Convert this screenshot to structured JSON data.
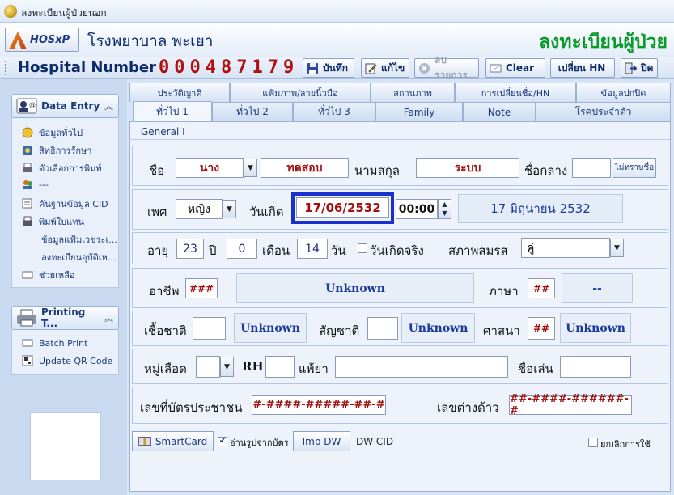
{
  "window": {
    "title": "ลงทะเบียนผู้ป่วยนอก"
  },
  "banner": {
    "logo_text": "HOSxP",
    "hospital_name": "โรงพยาบาล พะเยา",
    "page_title": "ลงทะเบียนผู้ป่วย"
  },
  "toolbar": {
    "hn_label": "Hospital Number",
    "hn_value": "000487179",
    "save": "บันทึก",
    "edit": "แก้ไข",
    "delete": "ลบรายการ",
    "clear": "Clear",
    "change_hn": "เปลี่ยน HN",
    "close": "ปิด"
  },
  "sidebar": {
    "data_entry": {
      "title": "Data Entry",
      "items": [
        "ข้อมูลทั่วไป",
        "สิทธิการรักษา",
        "ตัวเลือกการพิมพ์",
        "---",
        "ค้นฐานข้อมูล CID",
        "พิมพ์ใบแทน",
        "ข้อมูลแฟ้มเวชระเ...",
        "ลงทะเบียนอุบัติเห...",
        "ช่วยเหลือ"
      ]
    },
    "printing": {
      "title": "Printing T...",
      "items": [
        "Batch Print",
        "Update QR Code"
      ]
    }
  },
  "tabs_row1": [
    "ประวัติญาติ",
    "แฟ้มภาพ/ลายนิ้วมือ",
    "สถานภาพ",
    "การเปลี่ยนชื่อ/HN",
    "ข้อมูลปกปิด"
  ],
  "tabs_row2": [
    "ทั่วไป 1",
    "ทั่วไป 2",
    "ทั่วไป 3",
    "Family",
    "Note",
    "โรคประจำตัว"
  ],
  "general_label": "General I",
  "form": {
    "name_label": "ชื่อ",
    "prefix": "นาง",
    "first_name": "ทดสอบ",
    "last_name_label": "นามสกุล",
    "last_name": "ระบบ",
    "middle_name_label": "ชื่อกลาง",
    "middle_name": "",
    "unknown_name_btn": "ไม่ทราบชื่อ",
    "sex_label": "เพศ",
    "sex": "หญิง",
    "dob_label": "วันเกิด",
    "dob": "17/06/2532",
    "time": "00:00",
    "dob_text": "17 มิถุนายน 2532",
    "age_label": "อายุ",
    "age_years": "23",
    "years_unit": "ปี",
    "age_months": "0",
    "months_unit": "เดือน",
    "age_days": "14",
    "days_unit": "วัน",
    "real_dob_label": "วันเกิดจริง",
    "marital_label": "สภาพสมรส",
    "marital": "คู่",
    "occupation_label": "อาชีพ",
    "occupation_code": "###",
    "occupation_name": "Unknown",
    "language_label": "ภาษา",
    "language_code": "##",
    "language_name": "--",
    "race_label": "เชื้อชาติ",
    "race_code": "",
    "race_name": "Unknown",
    "nationality_label": "สัญชาติ",
    "nationality_code": "",
    "nationality_name": "Unknown",
    "religion_label": "ศาสนา",
    "religion_code": "##",
    "religion_name": "Unknown",
    "blood_label": "หมู่เลือด",
    "blood": "",
    "rh_label": "RH",
    "rh": "",
    "allergy_label": "แพ้ยา",
    "allergy": "",
    "nickname_label": "ชื่อเล่น",
    "nickname": "",
    "cid_label": "เลขที่บัตรประชาชน",
    "cid": "#-####-#####-##-#",
    "foreign_label": "เลขต่างด้าว",
    "foreign_id": "##-####-######-#"
  },
  "bottom": {
    "smartcard": "SmartCard",
    "read_photo": "อ่านรูปจากบัตร",
    "imp_dw": "Imp DW",
    "dw_cid": "DW CID —",
    "cancel_use": "ยกเลิกการใช้"
  },
  "colors": {
    "accent_green": "#0a9a2a",
    "hn_red": "#b01010",
    "highlight_blue": "#1a2fd0"
  }
}
